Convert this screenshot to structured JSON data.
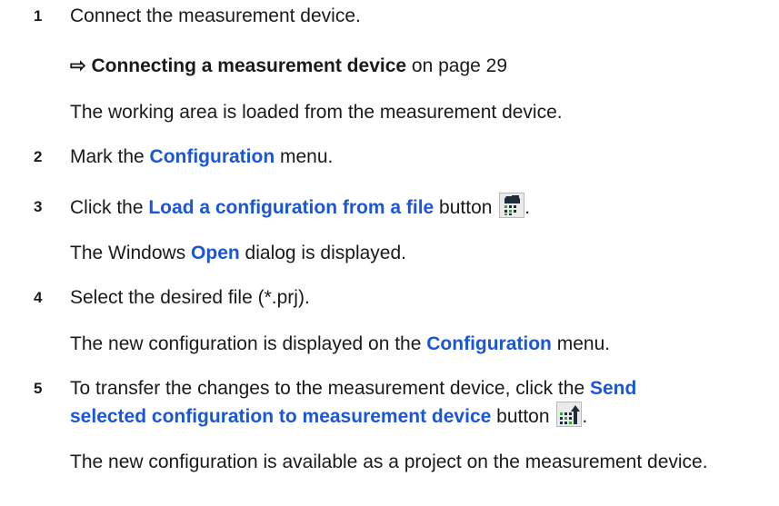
{
  "steps": [
    {
      "number": "1",
      "text": "Connect the measurement device.",
      "link_arrow": "⇨",
      "link_title": "Connecting a measurement device",
      "link_suffix": " on page 29",
      "result": "The working area is loaded from the measurement device."
    },
    {
      "number": "2",
      "pre": "Mark the ",
      "menu": "Configuration",
      "post": " menu."
    },
    {
      "number": "3",
      "pre": "Click the ",
      "button_name": "Load a configuration from a file",
      "post": " button",
      "end": ".",
      "result_pre": "The Windows ",
      "result_dialog": "Open",
      "result_post": " dialog is displayed."
    },
    {
      "number": "4",
      "text": "Select the desired file (*.prj).",
      "result_pre": "The new configuration is displayed on the ",
      "result_menu": "Configuration",
      "result_post": " menu."
    },
    {
      "number": "5",
      "pre": "To transfer the changes to the measurement device, click the ",
      "button_name_line1": "Send",
      "button_name_line2": "selected configuration to measurement device",
      "post": " button",
      "end": ".",
      "result": "The new configuration is available as a project on the measurement device."
    }
  ],
  "icons": {
    "load": "load-configuration-icon",
    "send": "send-configuration-icon"
  },
  "colors": {
    "text": "#1a1a1a",
    "accent": "#1a56d6",
    "icon_dark": "#1f2d3a",
    "icon_green": "#3aa23a"
  }
}
